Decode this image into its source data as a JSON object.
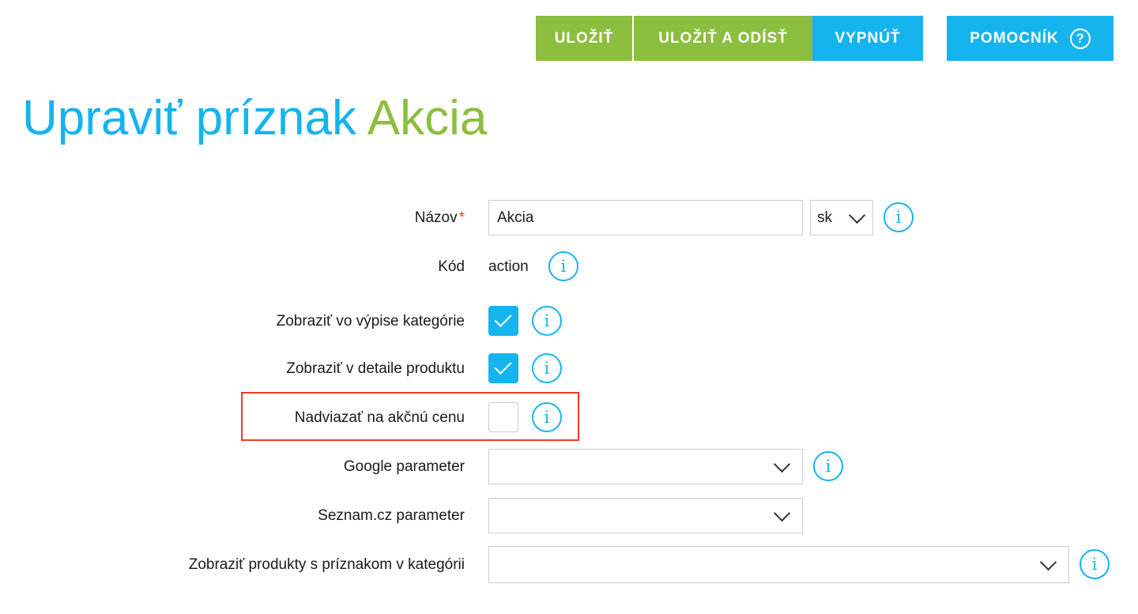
{
  "toolbar": {
    "save_label": "ULOŽIŤ",
    "save_exit_label": "ULOŽIŤ A ODÍSŤ",
    "off_label": "VYPNÚŤ",
    "help_label": "POMOCNÍK",
    "help_icon_glyph": "?"
  },
  "heading": {
    "prefix": "Upraviť príznak",
    "name": "Akcia"
  },
  "form": {
    "name": {
      "label": "Názov",
      "required_mark": "*",
      "value": "Akcia",
      "language": "sk"
    },
    "code": {
      "label": "Kód",
      "value": "action"
    },
    "show_in_category_listing": {
      "label": "Zobraziť vo výpise kategórie",
      "checked": true
    },
    "show_in_product_detail": {
      "label": "Zobraziť v detaile produktu",
      "checked": true
    },
    "link_to_action_price": {
      "label": "Nadviazať na akčnú cenu",
      "checked": false
    },
    "google_parameter": {
      "label": "Google parameter",
      "value": ""
    },
    "seznam_parameter": {
      "label": "Seznam.cz parameter",
      "value": ""
    },
    "show_products_in_category": {
      "label": "Zobraziť produkty s príznakom v kategórii",
      "value": ""
    }
  },
  "info_icon_glyph": "i",
  "colors": {
    "accent_blue": "#16b4ef",
    "accent_green": "#8cbe3f",
    "highlight_red": "#ee3a2a"
  }
}
